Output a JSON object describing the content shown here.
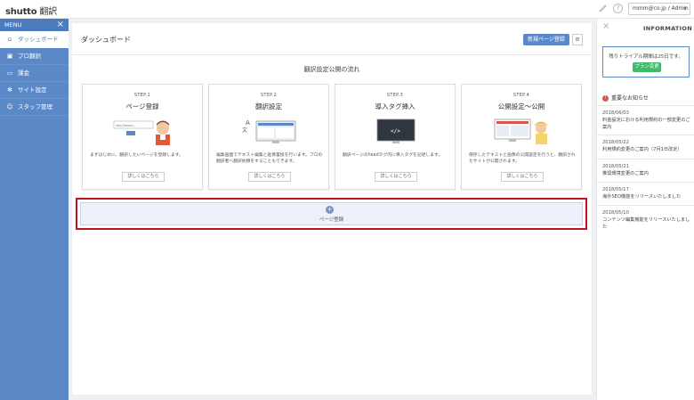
{
  "topbar": {
    "logo_brand": "shutto",
    "logo_suffix": "翻訳",
    "user_menu": "mmm@co.jp / Admin"
  },
  "sidebar": {
    "header": "MENU",
    "items": [
      {
        "label": "ダッシュボード",
        "icon": "home-icon"
      },
      {
        "label": "プロ翻訳",
        "icon": "translate-icon"
      },
      {
        "label": "課金",
        "icon": "credit-card-icon"
      },
      {
        "label": "サイト設定",
        "icon": "gear-icon"
      },
      {
        "label": "スタッフ管理",
        "icon": "users-icon"
      }
    ]
  },
  "main": {
    "title": "ダッシュボード",
    "new_page_button": "新規ページ登録",
    "flow_title": "翻訳設定公開の流れ",
    "steps": [
      {
        "step": "STEP.1",
        "title": "ページ登録",
        "desc": "まずはじめに、翻訳したいページを登録します。",
        "more": "詳しくはこちら",
        "url_text": "http://www.s..."
      },
      {
        "step": "STEP.2",
        "title": "翻訳設定",
        "desc": "編集画面でテキスト編集と画像置換を行います。プロの翻訳者へ翻訳依頼をすることもできます。",
        "more": "詳しくはこちら"
      },
      {
        "step": "STEP.3",
        "title": "導入タグ挿入",
        "desc": "翻訳ページのheadタグ内に導入タグを記述します。",
        "more": "詳しくはこちら"
      },
      {
        "step": "STEP.4",
        "title": "公開設定〜公開",
        "desc": "保存したテキストと画像の公開設定を行うと、翻訳されたサイトが公開されます。",
        "more": "詳しくはこちら"
      }
    ],
    "add_page_label": "ページ登録"
  },
  "rpanel": {
    "title": "INFORMATION",
    "trial_text": "残りトライアル期間は25日です。",
    "plan_button": "プラン変更",
    "notice_title": "重要なお知らせ",
    "news": [
      {
        "date": "2018/06/03",
        "text": "料金設定における利用規約の一部変更のご案内"
      },
      {
        "date": "2018/05/22",
        "text": "利用規約変更のご案内（7月1日改定）"
      },
      {
        "date": "2018/05/21",
        "text": "推奨環境変更のご案内"
      },
      {
        "date": "2018/05/17",
        "text": "海外SEO機能をリリースいたしました"
      },
      {
        "date": "2018/05/10",
        "text": "コンテンツ編集機能をリリースいたしました"
      }
    ]
  },
  "colors": {
    "accent": "#5b89c7",
    "highlight_border": "#c1131b",
    "plan_button": "#3fb96a"
  }
}
